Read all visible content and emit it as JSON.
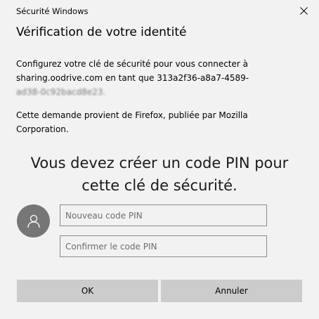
{
  "window": {
    "title": "Sécurité Windows",
    "close_icon": "close-icon"
  },
  "main": {
    "heading": "Vérification de votre identité",
    "intro_lines": [
      "Configurez votre clé de sécurité pour vous connecter à",
      "sharing.oodrive.com en tant que 313a2f36-a8a7-4589-",
      "ad38-0c92bacd8e23."
    ],
    "request_lines": [
      "Cette demande provient de Firefox, publiée par Mozilla",
      "Corporation."
    ],
    "pin_message_lines": [
      "Vous devez créer un code PIN pour",
      "cette clé de sécurité."
    ]
  },
  "form": {
    "avatar_icon": "user-icon",
    "new_pin": {
      "value": "",
      "placeholder": "Nouveau code PIN"
    },
    "confirm_pin": {
      "value": "",
      "placeholder": "Confirmer le code PIN"
    }
  },
  "buttons": {
    "ok_label": "OK",
    "cancel_label": "Annuler"
  },
  "colors": {
    "background": "#f2f2f2",
    "button": "#cccccc",
    "avatar": "#767676",
    "input_border": "#8a8a8a"
  }
}
